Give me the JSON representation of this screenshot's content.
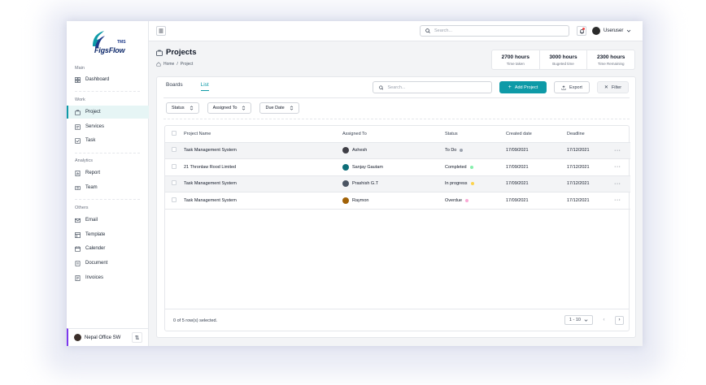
{
  "colors": {
    "accent": "#0e9aa7",
    "brand": "#0f2a6b",
    "notify": "#ef4444"
  },
  "logo": {
    "tms": "TMS",
    "brand": "FigsFlow"
  },
  "sidebar": {
    "sections": [
      {
        "label": "Main",
        "items": [
          {
            "label": "Dashboard",
            "icon": "grid-icon"
          }
        ]
      },
      {
        "label": "Work",
        "items": [
          {
            "label": "Project",
            "icon": "briefcase-icon",
            "active": true
          },
          {
            "label": "Services",
            "icon": "services-icon"
          },
          {
            "label": "Task",
            "icon": "task-icon"
          }
        ]
      },
      {
        "label": "Analytics",
        "items": [
          {
            "label": "Report",
            "icon": "report-icon"
          },
          {
            "label": "Team",
            "icon": "team-icon"
          }
        ]
      },
      {
        "label": "Others",
        "items": [
          {
            "label": "Email",
            "icon": "mail-icon"
          },
          {
            "label": "Template",
            "icon": "template-icon"
          },
          {
            "label": "Calender",
            "icon": "calendar-icon"
          },
          {
            "label": "Document",
            "icon": "document-icon"
          },
          {
            "label": "Invoices",
            "icon": "invoice-icon"
          }
        ]
      }
    ],
    "office": {
      "label": "Nepal Office SW",
      "switch_icon": "swap-vertical-icon"
    }
  },
  "header": {
    "search_placeholder": "Search...",
    "user_name": "Useruser"
  },
  "page": {
    "title": "Projects",
    "breadcrumb": {
      "home": "Home",
      "sep": "/",
      "current": "Project"
    }
  },
  "stats": [
    {
      "value": "2700 hours",
      "label": "Time taken"
    },
    {
      "value": "3000 hours",
      "label": "Bugeted time"
    },
    {
      "value": "2300 hours",
      "label": "Time Remaining"
    }
  ],
  "toolbar": {
    "tabs": [
      {
        "label": "Boards",
        "active": false
      },
      {
        "label": "List",
        "active": true
      }
    ],
    "search_placeholder": "Search...",
    "add_label": "Add Project",
    "export_label": "Export",
    "filter_label": "Filter"
  },
  "filters": [
    "Status",
    "Assigned To",
    "Due Date"
  ],
  "table": {
    "columns": [
      "Project Name",
      "Assigned To",
      "Status",
      "Created date",
      "Deadline"
    ],
    "rows": [
      {
        "name": "Task Management System",
        "assignee": "Ashesh",
        "avatar_color": "#3f3f46",
        "status": "To Do",
        "status_color": "#9ca3af",
        "created": "17/09/2021",
        "deadline": "17/12/2021",
        "shade": true
      },
      {
        "name": "21 Thronlaw Rood Limited",
        "assignee": "Sanjay Gautam",
        "avatar_color": "#0e6e78",
        "avatar_initials": "SG",
        "status": "Completed",
        "status_color": "#86efac",
        "created": "17/09/2021",
        "deadline": "17/12/2021",
        "shade": false
      },
      {
        "name": "Task Management System",
        "assignee": "Prashish G.T",
        "avatar_color": "#4b5563",
        "status": "In progress",
        "status_color": "#fcd34d",
        "created": "17/09/2021",
        "deadline": "17/12/2021",
        "shade": true
      },
      {
        "name": "Task Management System",
        "assignee": "Raymon",
        "avatar_color": "#a16207",
        "status": "Overdue",
        "status_color": "#f9a8d4",
        "created": "17/09/2021",
        "deadline": "17/12/2021",
        "shade": false
      }
    ],
    "selection_text": "0 of 5 row(s) selected.",
    "page_size": "1 - 10"
  }
}
